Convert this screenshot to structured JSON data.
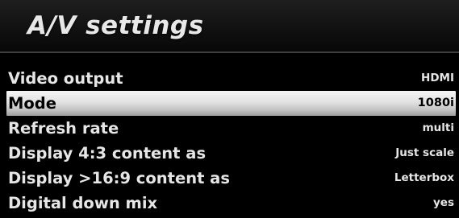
{
  "header": {
    "title": "A/V settings"
  },
  "settings": [
    {
      "label": "Video output",
      "value": "HDMI"
    },
    {
      "label": "Mode",
      "value": "1080i"
    },
    {
      "label": "Refresh rate",
      "value": "multi"
    },
    {
      "label": "Display 4:3 content as",
      "value": "Just scale"
    },
    {
      "label": "Display >16:9 content as",
      "value": "Letterbox"
    },
    {
      "label": "Digital down mix",
      "value": "yes"
    }
  ],
  "selected_index": 1,
  "colors": {
    "background": "#000000",
    "text": "#e6e6e6",
    "selected_text": "#000000",
    "selected_bar": "#d8d8d8"
  }
}
